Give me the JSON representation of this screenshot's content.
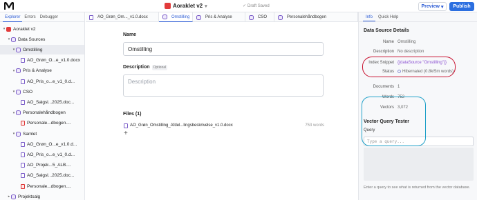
{
  "app": {
    "title": "Aoraklet v2",
    "draft_status": "Draft Saved"
  },
  "toolbar": {
    "preview_label": "Preview",
    "publish_label": "Publish"
  },
  "sidebar": {
    "tabs": [
      "Explorer",
      "Errors",
      "Debugger"
    ],
    "tree": [
      {
        "label": "Aoraklet v2",
        "icon": "app-icon",
        "depth": 0,
        "toggle": "▾"
      },
      {
        "label": "Data Sources",
        "icon": "database-icon",
        "depth": 1,
        "toggle": "▾"
      },
      {
        "label": "Omstilling",
        "icon": "database-icon",
        "depth": 2,
        "toggle": "▾",
        "selected": true
      },
      {
        "label": "AO_Grøn_O...e_v1.0.docx",
        "icon": "document-icon",
        "depth": 3,
        "toggle": ""
      },
      {
        "label": "Pris & Analyse",
        "icon": "database-icon",
        "depth": 2,
        "toggle": "▾"
      },
      {
        "label": "AO_Pris_o...e_v1_0.d...",
        "icon": "document-icon",
        "depth": 3,
        "toggle": ""
      },
      {
        "label": "CSO",
        "icon": "database-icon",
        "depth": 2,
        "toggle": "▾"
      },
      {
        "label": "AO_Salgsl...2025.doc...",
        "icon": "document-icon",
        "depth": 3,
        "toggle": ""
      },
      {
        "label": "Personalehåndbogen",
        "icon": "database-icon",
        "depth": 2,
        "toggle": "▾"
      },
      {
        "label": "Personale...dbogen....",
        "icon": "pdf-icon",
        "depth": 3,
        "toggle": ""
      },
      {
        "label": "Samlet",
        "icon": "database-icon",
        "depth": 2,
        "toggle": "▾"
      },
      {
        "label": "AO_Grøn_O...e_v1.0.d...",
        "icon": "document-icon",
        "depth": 3,
        "toggle": ""
      },
      {
        "label": "AO_Pris_o...e_v1_0.d...",
        "icon": "document-icon",
        "depth": 3,
        "toggle": ""
      },
      {
        "label": "AO_Projek...5_ALB....",
        "icon": "document-icon",
        "depth": 3,
        "toggle": ""
      },
      {
        "label": "AO_Salgsl...2025.doc...",
        "icon": "document-icon",
        "depth": 3,
        "toggle": ""
      },
      {
        "label": "Personale...dbogen....",
        "icon": "pdf-icon",
        "depth": 3,
        "toggle": ""
      },
      {
        "label": "Projektsalg",
        "icon": "database-icon",
        "depth": 1,
        "toggle": "▸"
      }
    ]
  },
  "doctabs": [
    {
      "label": "AO_Grøn_Om..._v1.0.docx",
      "icon": "document-icon",
      "active": false
    },
    {
      "label": "Omstilling",
      "icon": "database-icon",
      "active": true
    },
    {
      "label": "Pris & Analyse",
      "icon": "database-icon",
      "active": false
    },
    {
      "label": "CSO",
      "icon": "database-icon",
      "active": false
    },
    {
      "label": "Personalehåndbogen",
      "icon": "database-icon",
      "active": false
    }
  ],
  "form": {
    "name_label": "Name",
    "name_value": "Omstilling",
    "description_label": "Description",
    "optional_badge": "Optional",
    "description_placeholder": "Description",
    "files_label": "Files (1)",
    "file_name": "AO_Grøn_Omstilling_Afdel...lingsbeskrivelse_v1.0.docx",
    "file_words": "753 words",
    "add_symbol": "+"
  },
  "rightpanel": {
    "tabs": [
      "Info",
      "Quick Help"
    ],
    "heading": "Data Source Details",
    "details": [
      {
        "key": "Name",
        "value": "Omstilling"
      },
      {
        "key": "Description",
        "value": "No description"
      },
      {
        "key": "Index Snippet",
        "value": "{{dataSource \"Omstilling\"}}"
      },
      {
        "key": "Status",
        "value": "Hibernated (0.8k/5m words)"
      },
      {
        "key": "Documents",
        "value": "1"
      },
      {
        "key": "Words",
        "value": "752"
      },
      {
        "key": "Vectors",
        "value": "3,072"
      }
    ],
    "vq_heading": "Vector Query Tester",
    "query_label": "Query",
    "query_placeholder": "Type a query...",
    "help_text": "Enter a query to see what is returned from the vector database."
  },
  "colors": {
    "accent": "#2c6fe0",
    "highlight_red": "#c8102e",
    "highlight_cyan": "#1ea0c8",
    "snippet_purple": "#8a4fd1"
  }
}
